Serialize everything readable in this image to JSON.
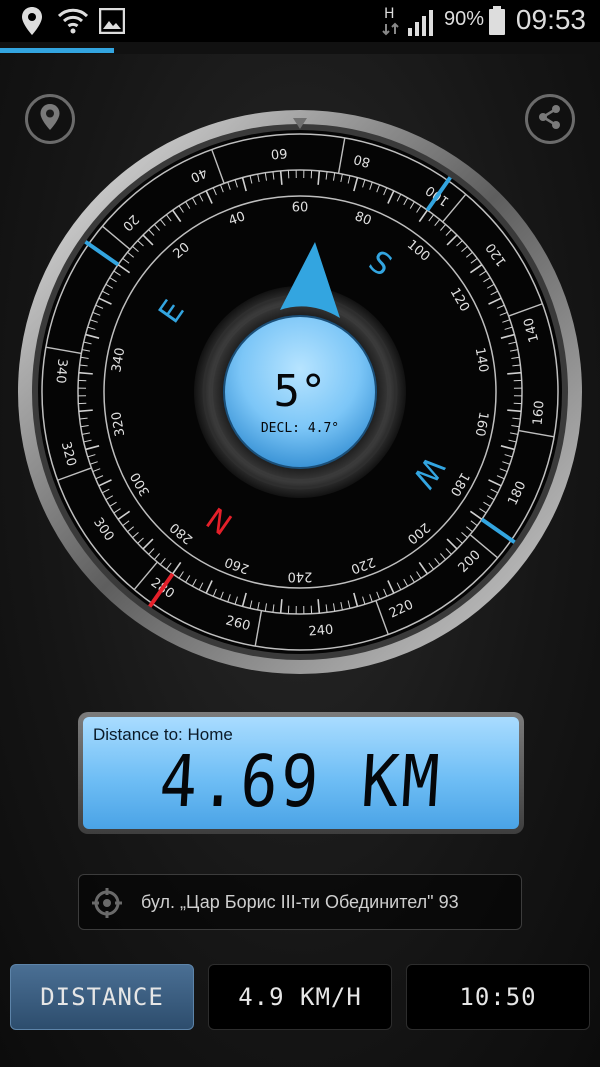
{
  "status_bar": {
    "icons": [
      "location-icon",
      "wifi-icon",
      "image-icon",
      "h-signal-icon",
      "cell-signal-icon",
      "battery-icon"
    ],
    "network_type": "H",
    "battery": "90%",
    "time": "09:53"
  },
  "toolbar": {
    "location_button_icon": "map-pin-icon",
    "share_button_icon": "share-icon"
  },
  "compass": {
    "heading": "5°",
    "declination": "DECL: 4.7°",
    "cardinals": {
      "north": "N",
      "east": "E",
      "south": "S",
      "west": "W"
    },
    "outer_labels": [
      "20",
      "40",
      "60",
      "80",
      "100",
      "120",
      "140",
      "160",
      "180",
      "200",
      "220",
      "240",
      "260",
      "280",
      "300",
      "320",
      "340"
    ],
    "inner_labels": [
      "20",
      "40",
      "60",
      "80",
      "100",
      "120",
      "140",
      "160",
      "180",
      "200",
      "220",
      "240",
      "260",
      "280",
      "300",
      "320",
      "340"
    ],
    "colors": {
      "accent": "#33a5e0",
      "north": "#e5202a",
      "lcd": "#7cc6f7"
    }
  },
  "distance": {
    "label": "Distance to: Home",
    "value": "4.69 KM"
  },
  "address": {
    "icon": "crosshair-icon",
    "text": "бул. „Цар Борис III-ти Обединител\" 93"
  },
  "bottom_buttons": {
    "distance_label": "DISTANCE",
    "speed_label": "4.9 KM/H",
    "time_label": "10:50"
  }
}
